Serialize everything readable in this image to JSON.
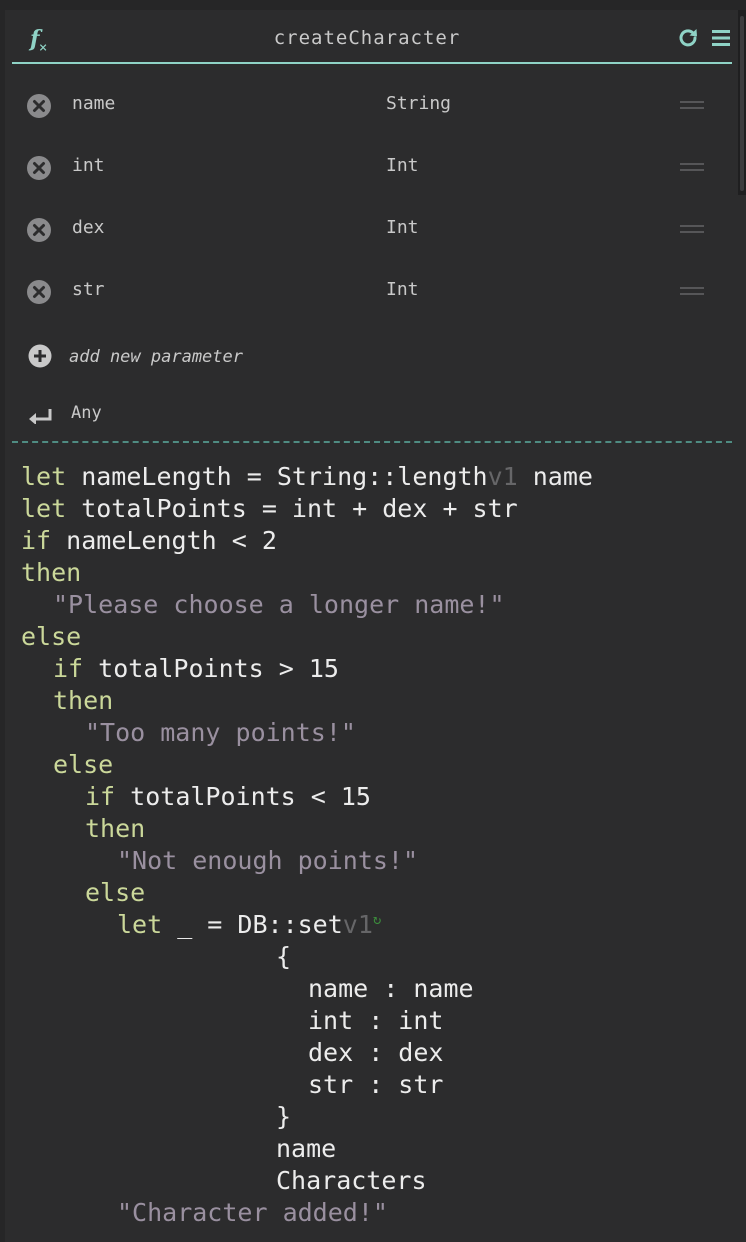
{
  "function_name": "createCharacter",
  "header_icons": {
    "left": "fx-icon",
    "refresh": "refresh-icon",
    "menu": "hamburger-menu-icon"
  },
  "parameters": [
    {
      "name": "name",
      "type": "String"
    },
    {
      "name": "int",
      "type": "Int"
    },
    {
      "name": "dex",
      "type": "Int"
    },
    {
      "name": "str",
      "type": "Int"
    }
  ],
  "add_parameter_label": "add new parameter",
  "return_type": "Any",
  "colors": {
    "accent": "#8fd3c6",
    "keyword": "#cbd89a",
    "string": "#9a90a0",
    "text": "#ececec",
    "version": "#666668",
    "refresh_badge": "#3c8c3c",
    "background": "#2c2c2d"
  },
  "code": {
    "l1": {
      "kw": "let",
      "a": " nameLength = String::length",
      "v": "v1",
      "b": " name"
    },
    "l2": {
      "kw": "let",
      "a": " totalPoints = int + dex + str"
    },
    "l3": {
      "kw": "if",
      "a": " nameLength < 2"
    },
    "l4": {
      "kw": "then"
    },
    "l5": {
      "s": "\"Please choose a longer name!\""
    },
    "l6": {
      "kw": "else"
    },
    "l7": {
      "kw": "if",
      "a": " totalPoints > 15"
    },
    "l8": {
      "kw": "then"
    },
    "l9": {
      "s": "\"Too many points!\""
    },
    "l10": {
      "kw": "else"
    },
    "l11": {
      "kw": "if",
      "a": " totalPoints < 15"
    },
    "l12": {
      "kw": "then"
    },
    "l13": {
      "s": "\"Not enough points!\""
    },
    "l14": {
      "kw": "else"
    },
    "l15": {
      "kw": "let",
      "a": " _ = DB::set",
      "v": "v1",
      "icon": "↻"
    },
    "l16": {
      "a": "{"
    },
    "l17": {
      "a": "name : name"
    },
    "l18": {
      "a": "int : int"
    },
    "l19": {
      "a": "dex : dex"
    },
    "l20": {
      "a": "str : str"
    },
    "l21": {
      "a": "}"
    },
    "l22": {
      "a": "name"
    },
    "l23": {
      "a": "Characters"
    },
    "l24": {
      "s": "\"Character added!\""
    }
  }
}
